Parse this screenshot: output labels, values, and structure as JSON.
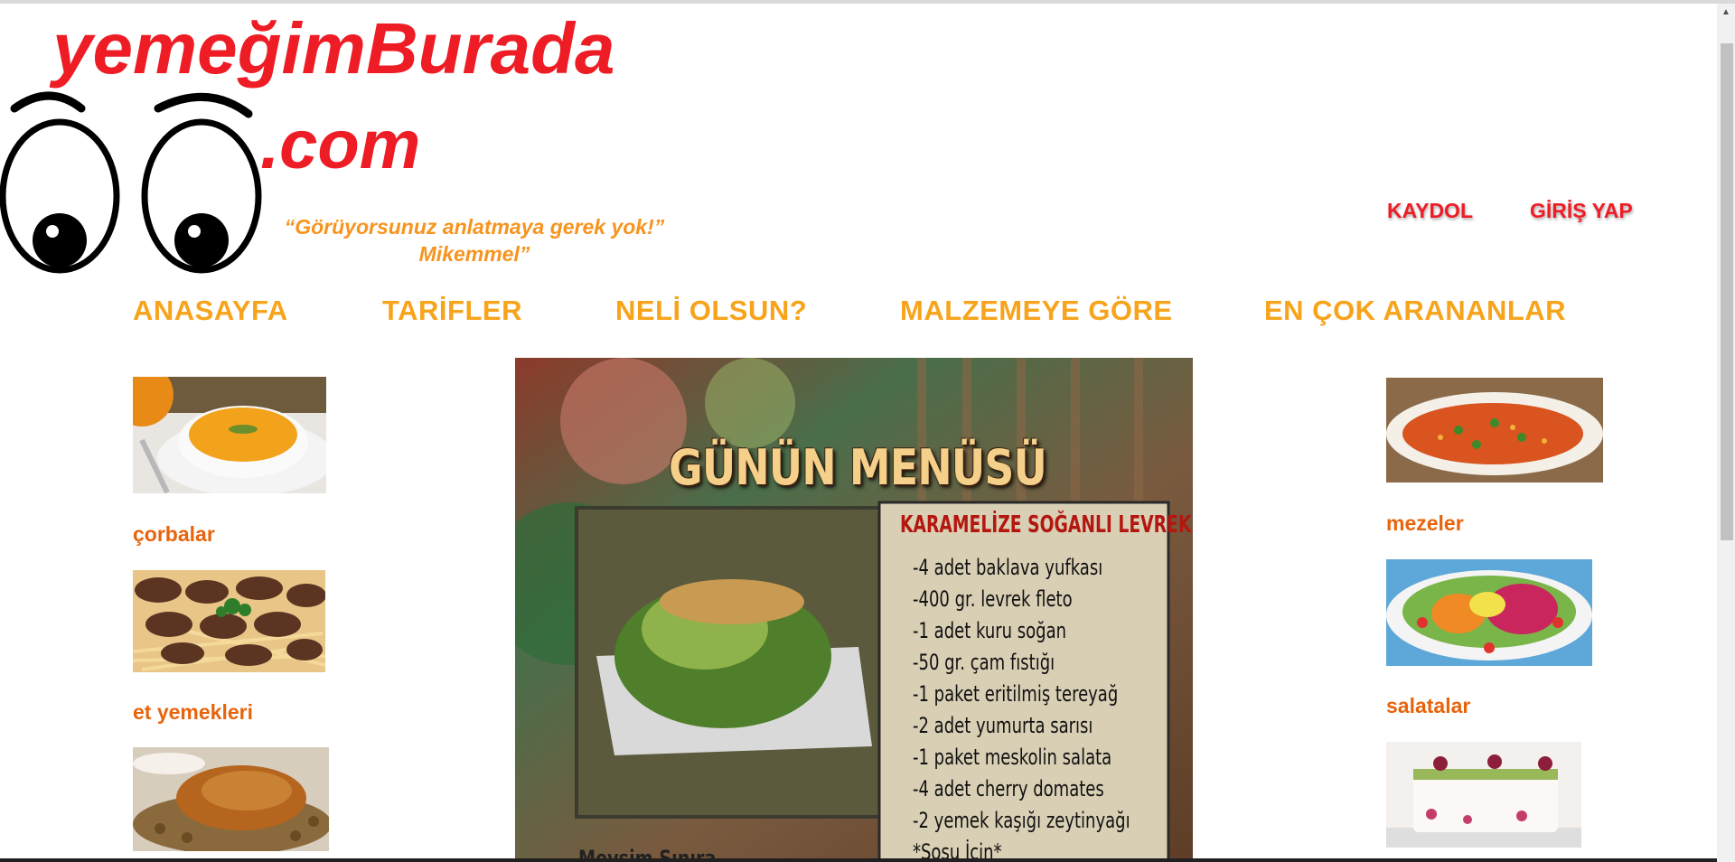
{
  "brand": {
    "name": "yemeğimBurada",
    "suffix": ".com",
    "slogan_line1": "“Görüyorsunuz anlatmaya gerek yok!”",
    "slogan_line2": "Mikemmel”"
  },
  "auth": {
    "signup": "KAYDOL",
    "login": "GİRİŞ YAP"
  },
  "nav": [
    {
      "label": "ANASAYFA"
    },
    {
      "label": "TARİFLER"
    },
    {
      "label": "NELİ OLSUN?"
    },
    {
      "label": "MALZEMEYE GÖRE"
    },
    {
      "label": "EN ÇOK ARANANLAR"
    }
  ],
  "left_categories": [
    {
      "label": "çorbalar",
      "image": "soup-image"
    },
    {
      "label": "et yemekleri",
      "image": "meatball-image"
    },
    {
      "label": "",
      "image": "roast-chicken-image"
    }
  ],
  "right_categories": [
    {
      "label": "mezeler",
      "image": "meze-image"
    },
    {
      "label": "salatalar",
      "image": "salad-image"
    },
    {
      "label": "",
      "image": "dessert-image"
    }
  ],
  "banner": {
    "title": "GÜNÜN MENÜSÜ",
    "recipe_name": "KARAMELİZE SOĞANLI LEVREK",
    "ingredients": [
      "-4 adet baklava yufkası",
      "-400 gr. levrek fleto",
      "-1 adet kuru soğan",
      "-50 gr. çam fıstığı",
      "-1 paket eritilmiş tereyağ",
      "-2 adet yumurta sarısı",
      "-1 paket meskolin salata",
      "-4 adet cherry domates",
      "-2 yemek kaşığı zeytinyağı",
      "*Sosu İçin*"
    ],
    "footer": "Mevsim Sınıra"
  },
  "colors": {
    "brand_red": "#ee1c25",
    "nav_orange": "#f7a41c",
    "category_orange": "#e8640c",
    "slogan_orange": "#f7941d"
  }
}
